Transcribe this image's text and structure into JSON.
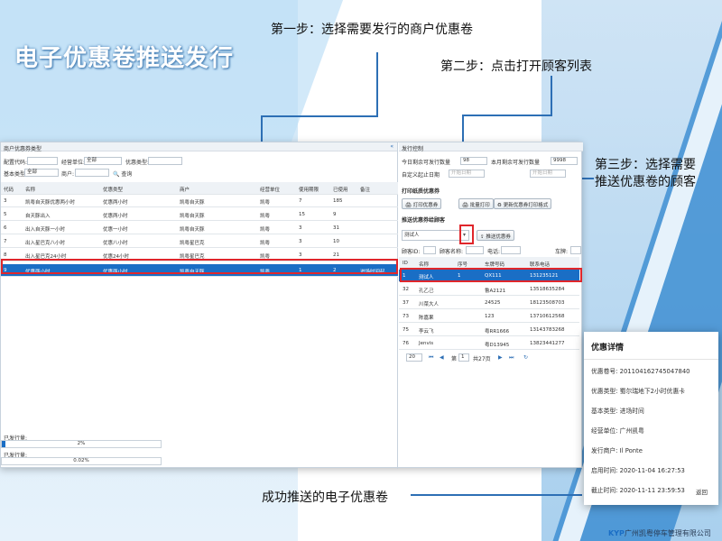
{
  "title": "电子优惠卷推送发行",
  "annotations": {
    "step1": "第一步：选择需要发行的商户优惠卷",
    "step2": "第二步：点击打开顾客列表",
    "step3_line1": "第三步：选择需要",
    "step3_line2": "推送优惠卷的顾客",
    "success": "成功推送的电子优惠卷"
  },
  "left_panel": {
    "header": "商户优惠券类型",
    "close_icon": "«",
    "filters": {
      "config_code_label": "配置代码:",
      "unit_label": "经营单位:",
      "unit_value": "全部",
      "coupon_type_label": "优惠类型:",
      "base_type_label": "基本类型:",
      "base_type_value": "全部",
      "merchant_label": "商户:",
      "search_label": "查询"
    },
    "columns": [
      "代码",
      "名称",
      "优惠类型",
      "商户",
      "经营单位",
      "使用期限",
      "已使用",
      "备注"
    ],
    "rows": [
      [
        "3",
        "凯粤自天豚优惠两小时",
        "优惠两小时",
        "凯粤自天豚",
        "凯粤",
        "7",
        "185",
        ""
      ],
      [
        "5",
        "自天豚出入",
        "优惠两小时",
        "凯粤自天豚",
        "凯粤",
        "15",
        "9",
        ""
      ],
      [
        "6",
        "出入自天豚一小时",
        "优惠一小时",
        "凯粤自天豚",
        "凯粤",
        "3",
        "31",
        ""
      ],
      [
        "7",
        "出入星巴克八小时",
        "优惠八小时",
        "凯粤星巴克",
        "凯粤",
        "3",
        "10",
        ""
      ],
      [
        "8",
        "出入星巴克24小时",
        "优惠24小时",
        "凯粤星巴克",
        "凯粤",
        "3",
        "21",
        ""
      ],
      [
        "9",
        "优惠两小时",
        "优惠两小时",
        "凯粤自天豚",
        "凯粤",
        "1",
        "2",
        "进场时间起"
      ]
    ],
    "issued_label": "已发行量:",
    "issued_value": "2%",
    "issued_fraction": 0.02,
    "used_label": "已发行量:",
    "used_value": "0.02%",
    "used_fraction": 0.0002
  },
  "right_panel": {
    "header": "发行控制",
    "today_label": "今日剩余可发行数量",
    "today_value": "98",
    "month_label": "本月剩余可发行数量",
    "month_value": "9998",
    "custom_label": "自定义起止日期",
    "start_placeholder": "开始日期",
    "end_placeholder": "开始日期",
    "print_section": "打印纸质优惠券",
    "print_btn": "打印优惠券",
    "batch_print_btn": "批量打印",
    "update_format_btn": "更新优惠券打印格式",
    "push_section": "推送优惠券给顾客",
    "customer_value": "测试人",
    "push_btn": "推送优惠券",
    "filter_id_label": "顾客ID:",
    "filter_name_label": "顾客名称:",
    "filter_phone_label": "电话:",
    "filter_plate_label": "车牌:",
    "columns": [
      "ID",
      "名称",
      "序号",
      "车牌号码",
      "联系电话"
    ],
    "rows": [
      [
        "1",
        "测试人",
        "1",
        "QX111",
        "131235121"
      ],
      [
        "32",
        "孔乙己",
        "",
        "鲁A2121",
        "13518635284"
      ],
      [
        "37",
        "川菜大人",
        "",
        "24525",
        "18123508703"
      ],
      [
        "73",
        "陈嘉果",
        "",
        "123",
        "13710612568"
      ],
      [
        "75",
        "李云飞",
        "",
        "粤RR1666",
        "13143783268"
      ],
      [
        "76",
        "Jenvis",
        "",
        "粤D13945",
        "13823441277"
      ]
    ],
    "pager": {
      "page_size": "20",
      "page_label": "第",
      "page_value": "1",
      "total_label": "共27页"
    }
  },
  "detail_card": {
    "title": "优惠详情",
    "fields": [
      {
        "label": "优惠卷号:",
        "value": "2011041627450478​40"
      },
      {
        "label": "优惠类型:",
        "value": "蜀尔瑞地下2小时优惠卡"
      },
      {
        "label": "基本类型:",
        "value": "进场时间"
      },
      {
        "label": "经营单位:",
        "value": "广州凯粤"
      },
      {
        "label": "发行商户:",
        "value": "Il Ponte"
      },
      {
        "label": "启用时间:",
        "value": "2020-11-04 16:27:53"
      },
      {
        "label": "截止时间:",
        "value": "2020-11-11 23:59:53"
      }
    ],
    "back": "返回"
  },
  "footer": {
    "brand": "KYP",
    "company": "广州凯粤停车管理有限公司"
  }
}
